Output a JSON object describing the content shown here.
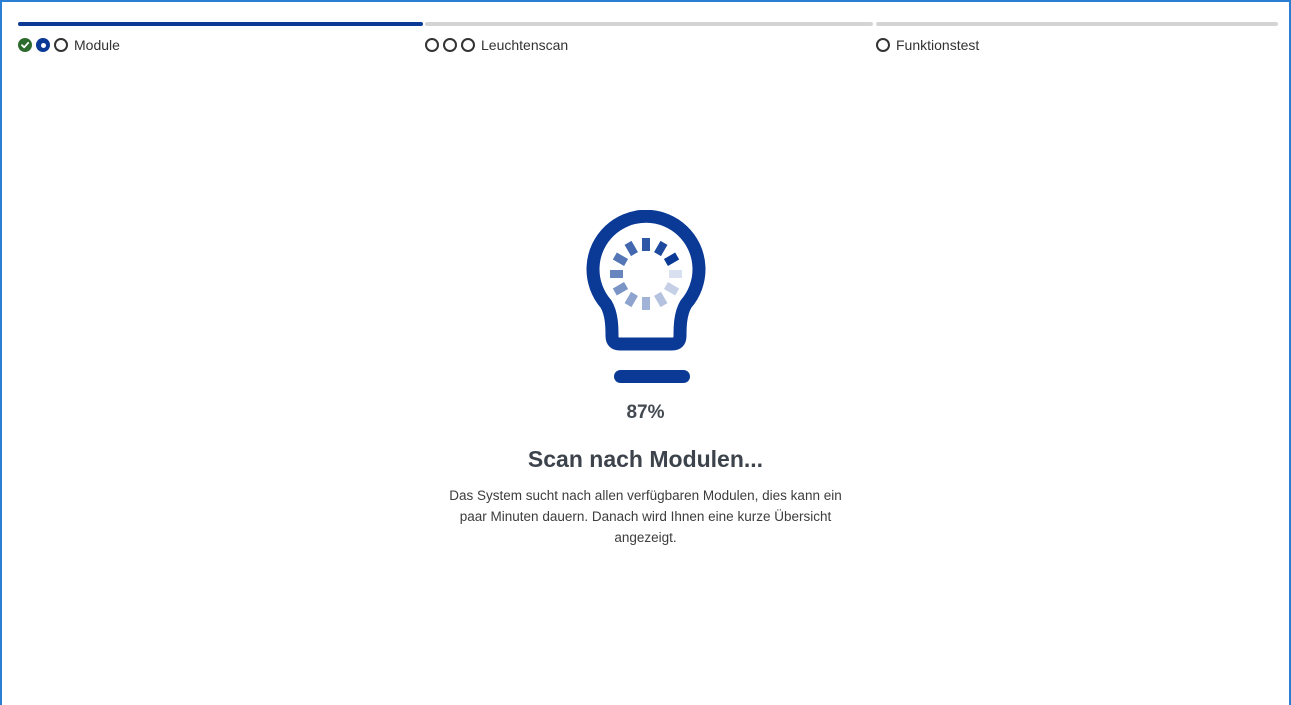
{
  "colors": {
    "accent": "#0a3a96",
    "done": "#2e6b2e",
    "bar_active": "#0a3a96",
    "bar_inactive": "#d4d4d4",
    "frame": "#2a7fd4"
  },
  "stepper": {
    "bars": [
      "active",
      "inactive",
      "inactive"
    ],
    "steps": [
      {
        "label": "Module",
        "dots": [
          "done",
          "current",
          "pending"
        ]
      },
      {
        "label": "Leuchtenscan",
        "dots": [
          "pending",
          "pending",
          "pending"
        ]
      },
      {
        "label": "Funktionstest",
        "dots": [
          "pending"
        ]
      }
    ]
  },
  "scan": {
    "icon": "lightbulb-spinner-icon",
    "progress": 0.87,
    "percent_label": "87%",
    "title": "Scan nach Modulen...",
    "description": "Das System sucht nach allen verfügbaren Modulen, dies kann ein paar Minuten dauern. Danach wird Ihnen eine kurze Übersicht angezeigt."
  }
}
